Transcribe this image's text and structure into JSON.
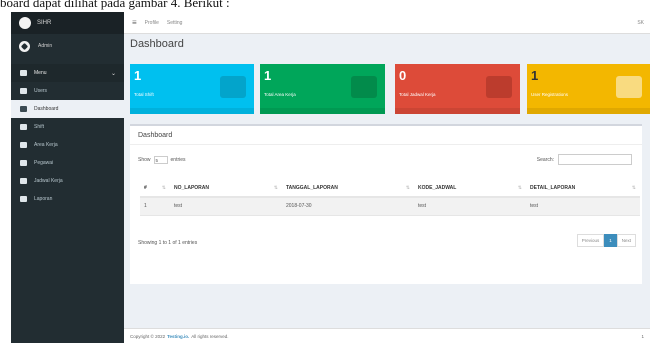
{
  "caption": "board dapat dilihat pada gambar 4. Berikut :",
  "brand": {
    "title": "SIHR"
  },
  "user": {
    "name": "Admin"
  },
  "sidebar": {
    "header": "Menu",
    "items": [
      {
        "label": "Users",
        "icon": "user-icon"
      },
      {
        "label": "Dashboard",
        "icon": "chart-icon"
      },
      {
        "label": "Shift",
        "icon": "calendar-icon"
      },
      {
        "label": "Area Kerja",
        "icon": "users-icon"
      },
      {
        "label": "Pegawai",
        "icon": "person-icon"
      },
      {
        "label": "Jadwal Kerja",
        "icon": "users-icon"
      },
      {
        "label": "Laporan",
        "icon": "book-icon"
      }
    ]
  },
  "topbar": {
    "crumb1": "Profile",
    "crumb2": "Setting",
    "right": "SK"
  },
  "page": {
    "title": "Dashboard"
  },
  "cards": [
    {
      "value": "1",
      "label": "Total Shift",
      "color": "#00c0ef"
    },
    {
      "value": "1",
      "label": "Total Area Kerja",
      "color": "#00a65a"
    },
    {
      "value": "0",
      "label": "Total Jadwal Kerja",
      "color": "#dd4b39"
    },
    {
      "value": "1",
      "label": "User Registrations",
      "color": "#f39c12"
    }
  ],
  "panel": {
    "title": "Dashboard",
    "show_prefix": "Show",
    "show_value": "5",
    "show_suffix": "entries",
    "search_label": "Search:",
    "columns": [
      "#",
      "NO_LAPORAN",
      "TANGGAL_LAPORAN",
      "KODE_JADWAL",
      "DETAIL_LAPORAN"
    ],
    "rows": [
      [
        "1",
        "test",
        "2018-07-30",
        "test",
        "test"
      ]
    ],
    "info": "Showing 1 to 1 of 1 entries",
    "prev": "Previous",
    "page": "1",
    "next": "Next"
  },
  "footer": {
    "prefix": "Copyright © 2022",
    "brand": "Testing.io.",
    "suffix": "All rights reserved.",
    "version": "1"
  }
}
